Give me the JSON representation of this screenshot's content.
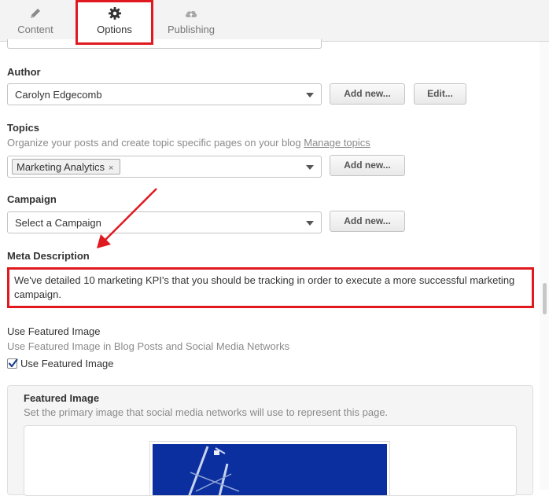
{
  "tabs": {
    "content": "Content",
    "options": "Options",
    "publishing": "Publishing"
  },
  "author": {
    "label": "Author",
    "selected": "Carolyn Edgecomb",
    "add_new": "Add new...",
    "edit": "Edit..."
  },
  "topics": {
    "label": "Topics",
    "help": "Organize your posts and create topic specific pages on your blog",
    "manage_link": "Manage topics",
    "chip": "Marketing Analytics",
    "chip_remove": "×",
    "add_new": "Add new..."
  },
  "campaign": {
    "label": "Campaign",
    "selected": "Select a Campaign",
    "add_new": "Add new..."
  },
  "meta": {
    "label": "Meta Description",
    "value": "We've detailed 10 marketing KPI's that you should be tracking in order to execute a more successful marketing campaign."
  },
  "featured": {
    "heading": "Use Featured Image",
    "help": "Use Featured Image in Blog Posts and Social Media Networks",
    "checkbox_label": "Use Featured Image",
    "checked": true,
    "panel_title": "Featured Image",
    "panel_help": "Set the primary image that social media networks will use to represent this page."
  },
  "colors": {
    "annotation_red": "#e0191f",
    "image_blue": "#0b2f9e"
  }
}
